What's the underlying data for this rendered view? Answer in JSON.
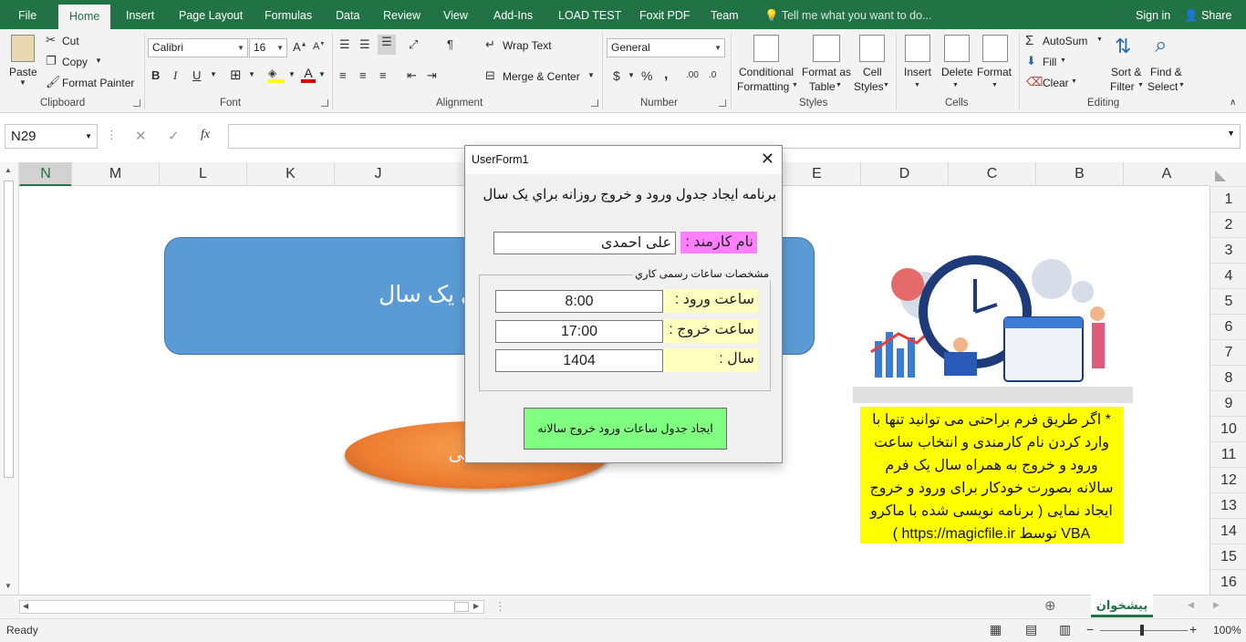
{
  "tabs": [
    "File",
    "Home",
    "Insert",
    "Page Layout",
    "Formulas",
    "Data",
    "Review",
    "View",
    "Add-Ins",
    "LOAD TEST",
    "Foxit PDF",
    "Team"
  ],
  "tell_me": "Tell me what you want to do...",
  "sign_in": "Sign in",
  "share": "Share",
  "clipboard": {
    "paste": "Paste",
    "cut": "Cut",
    "copy": "Copy",
    "format_painter": "Format Painter",
    "label": "Clipboard"
  },
  "font": {
    "name": "Calibri",
    "size": "16",
    "label": "Font",
    "bold": "B",
    "italic": "I",
    "underline": "U"
  },
  "alignment": {
    "wrap_text": "Wrap Text",
    "merge_center": "Merge & Center",
    "label": "Alignment"
  },
  "number": {
    "format": "General",
    "currency": "$",
    "percent": "%",
    "comma": ",",
    "inc_decimal": ".00",
    "dec_decimal": ".0",
    "label": "Number"
  },
  "styles": {
    "conditional": "Conditional",
    "formatting": "Formatting",
    "format_as": "Format as",
    "table": "Table",
    "cell": "Cell",
    "cell_styles": "Styles",
    "label": "Styles"
  },
  "cells": {
    "insert": "Insert",
    "delete": "Delete",
    "format": "Format",
    "label": "Cells"
  },
  "editing": {
    "autosum": "AutoSum",
    "fill": "Fill",
    "clear": "Clear",
    "sort": "Sort &",
    "filter": "Filter",
    "find": "Find &",
    "select": "Select",
    "label": "Editing"
  },
  "namebox": "N29",
  "fx": "fx",
  "columns": [
    "N",
    "M",
    "L",
    "K",
    "J",
    "E",
    "D",
    "C",
    "B",
    "A"
  ],
  "rows": [
    "1",
    "2",
    "3",
    "4",
    "5",
    "6",
    "7",
    "8",
    "9",
    "10",
    "11",
    "12",
    "13",
    "14",
    "15",
    "16"
  ],
  "banner_text": "رج روزانه براي يک سال",
  "ellipse_text": "ساعاتی",
  "note_text": "* اگر طريق فرم براحتی می توانيد تنها با وارد کردن نام کارمندی و انتخاب ساعت ورود و خروج به همراه سال يک فرم سالانه بصورت خودکار برای ورود و خروج ايجاد نمايی ( برنامه نويسی شده با ماکرو VBA توسط https://magicfile.ir )",
  "userform": {
    "title": "UserForm1",
    "close": "✕",
    "heading": "برنامه ايجاد جدول ورود و خروج روزانه براي يک سال",
    "employee_label": "نام کارمند :",
    "employee_value": "علی احمدی",
    "frame_caption": "مشخصات ساعات رسمی کاري",
    "entry_label": "ساعت ورود :",
    "entry_value": "8:00",
    "exit_label": "ساعت خروج :",
    "exit_value": "17:00",
    "year_label": "سال :",
    "year_value": "1404",
    "button": "ايجاد جدول ساعات ورود خروج سالانه"
  },
  "sheet_tab": "پيشخوان",
  "status": {
    "ready": "Ready",
    "zoom": "100%"
  },
  "colors": {
    "excel_green": "#217346",
    "banner_blue": "#5b9bd5",
    "orange": "#ed7d31",
    "note_yellow": "#ffff00",
    "button_green": "#80ff80",
    "label_pink": "#ff80ff",
    "label_yellow": "#ffffc0"
  }
}
